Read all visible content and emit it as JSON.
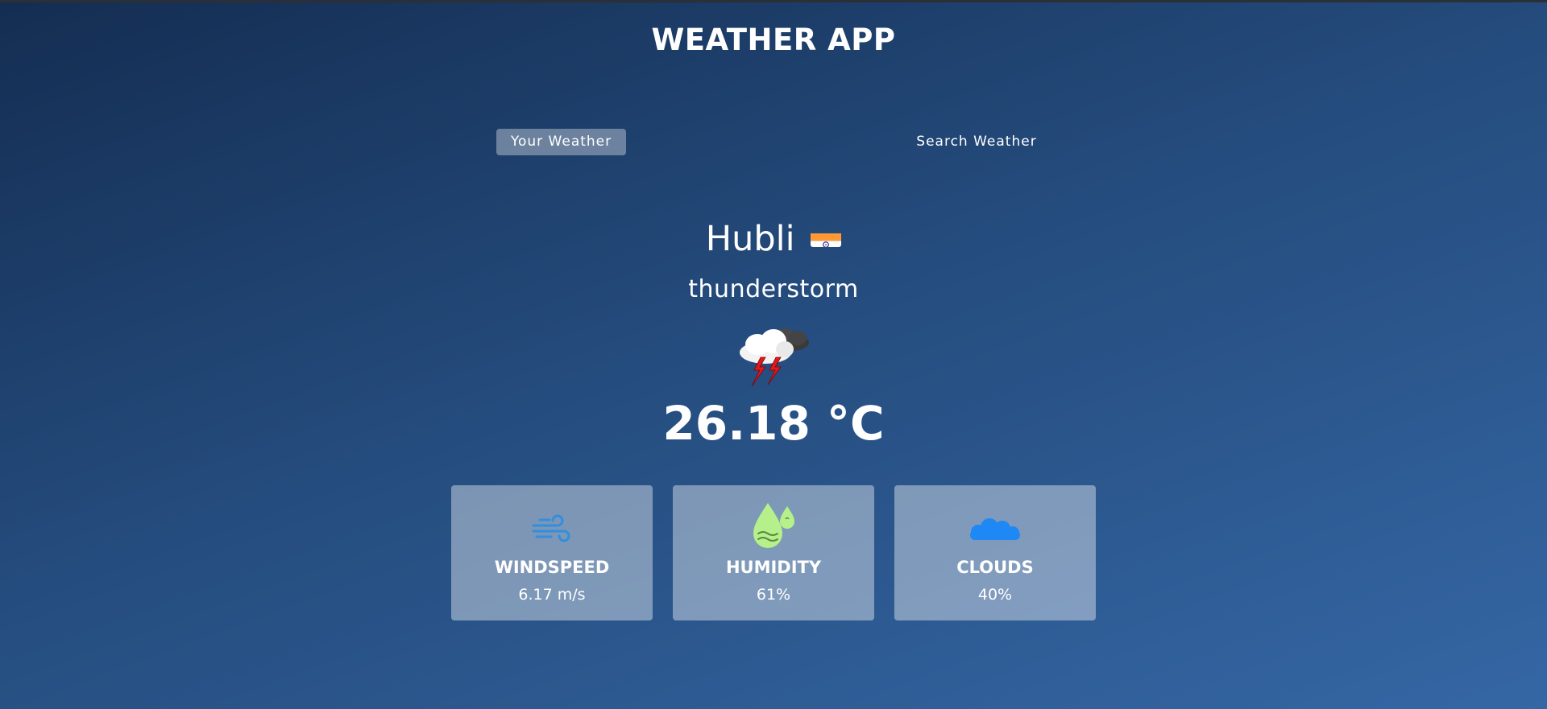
{
  "app": {
    "title": "WEATHER APP"
  },
  "tabs": [
    {
      "label": "Your Weather",
      "active": true
    },
    {
      "label": "Search Weather",
      "active": false
    }
  ],
  "weather": {
    "city": "Hubli",
    "country_flag": "india-flag",
    "description": "thunderstorm",
    "icon": "thunderstorm-icon",
    "temperature": "26.18 °C"
  },
  "stats": {
    "windspeed": {
      "label": "WINDSPEED",
      "value": "6.17 m/s",
      "icon": "wind-icon"
    },
    "humidity": {
      "label": "HUMIDITY",
      "value": "61%",
      "icon": "humidity-drop-icon"
    },
    "clouds": {
      "label": "CLOUDS",
      "value": "40%",
      "icon": "cloud-icon"
    }
  },
  "colors": {
    "background_start": "#142d52",
    "background_end": "#3567a5",
    "wind_icon": "#2f8fe0",
    "humidity_icon": "#b6f08a",
    "cloud_icon": "#1e88f5"
  }
}
